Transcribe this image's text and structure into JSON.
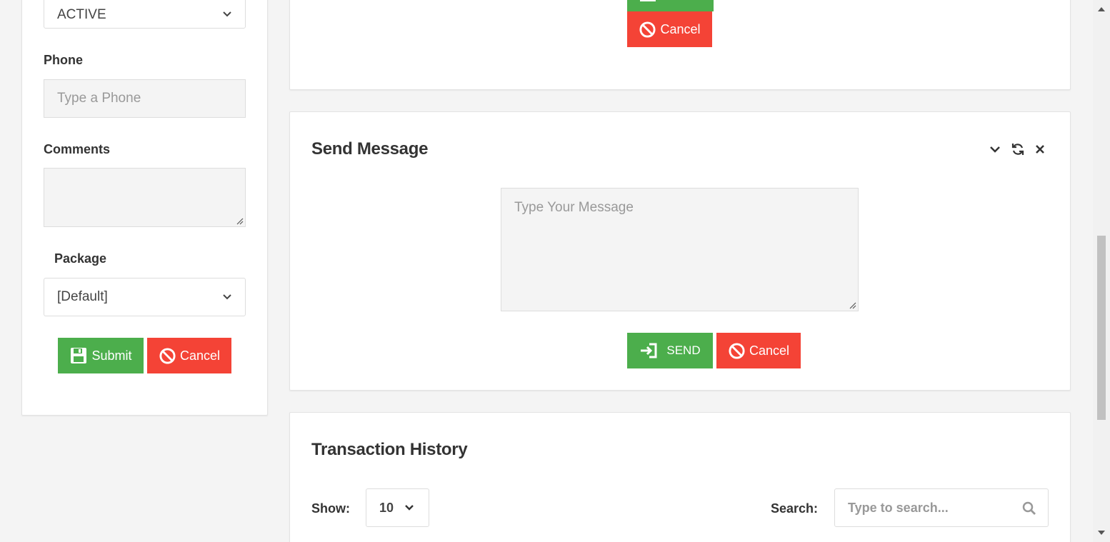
{
  "left_form": {
    "status_value": "ACTIVE",
    "phone_label": "Phone",
    "phone_placeholder": "Type a Phone",
    "comments_label": "Comments",
    "package_label": "Package",
    "package_value": "[Default]",
    "submit_label": "Submit",
    "cancel_label": "Cancel"
  },
  "top_card": {
    "cancel_label": "Cancel"
  },
  "send_message": {
    "title": "Send Message",
    "message_placeholder": "Type Your Message",
    "send_label": "SEND",
    "cancel_label": "Cancel"
  },
  "transaction_history": {
    "title": "Transaction History",
    "show_label": "Show:",
    "show_value": "10",
    "search_label": "Search:",
    "search_placeholder": "Type to search..."
  },
  "colors": {
    "success": "#4cae4c",
    "danger": "#f44336"
  }
}
